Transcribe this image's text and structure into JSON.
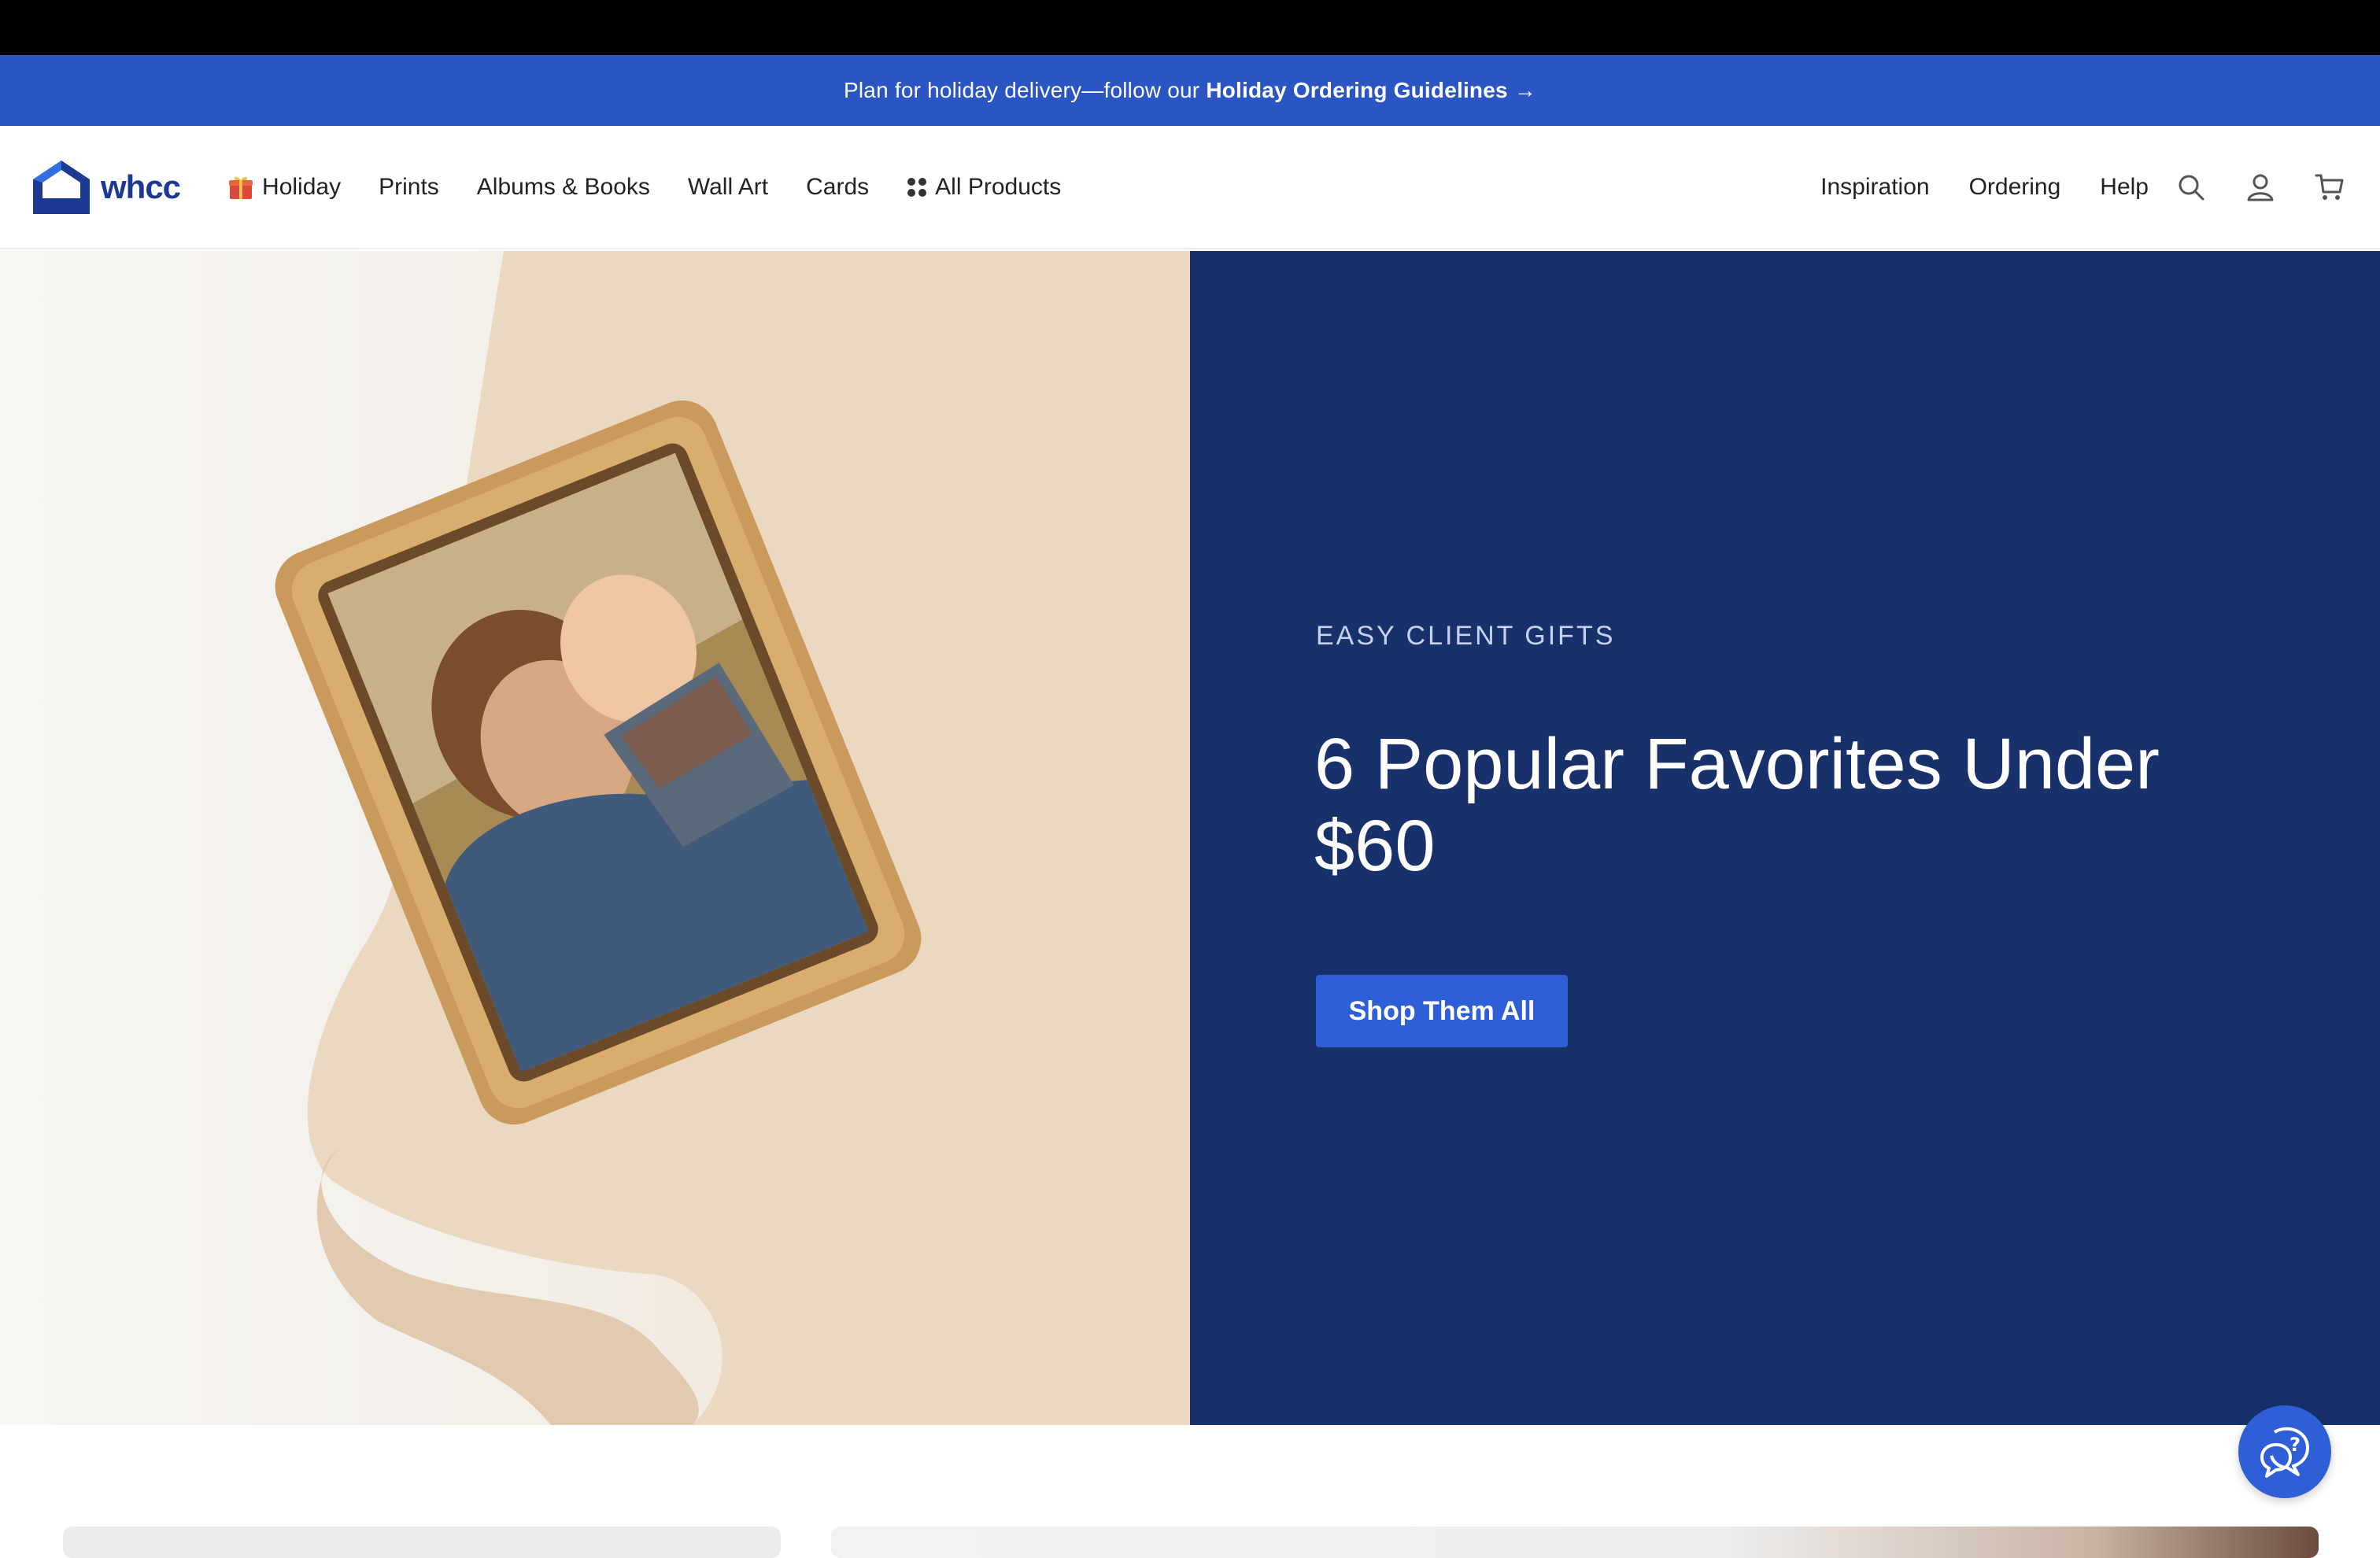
{
  "banner": {
    "text": "Plan for holiday delivery—follow our ",
    "link": "Holiday Ordering Guidelines",
    "arrow": "→"
  },
  "header": {
    "logo_text": "whcc",
    "nav_left": [
      {
        "label": "Holiday",
        "icon": "gift-icon"
      },
      {
        "label": "Prints"
      },
      {
        "label": "Albums & Books"
      },
      {
        "label": "Wall Art"
      },
      {
        "label": "Cards"
      },
      {
        "label": "All Products",
        "icon": "grid-dots-icon"
      }
    ],
    "nav_right": [
      {
        "label": "Inspiration"
      },
      {
        "label": "Ordering"
      },
      {
        "label": "Help"
      }
    ],
    "icons": [
      "search-icon",
      "account-icon",
      "cart-icon"
    ]
  },
  "hero": {
    "eyebrow": "EASY CLIENT GIFTS",
    "headline": "6 Popular Favorites Under $60",
    "cta": "Shop Them All"
  },
  "colors": {
    "banner": "#2a55c2",
    "hero_right": "#18316b",
    "cta": "#2f5fd7",
    "brand": "#1c3a91"
  }
}
